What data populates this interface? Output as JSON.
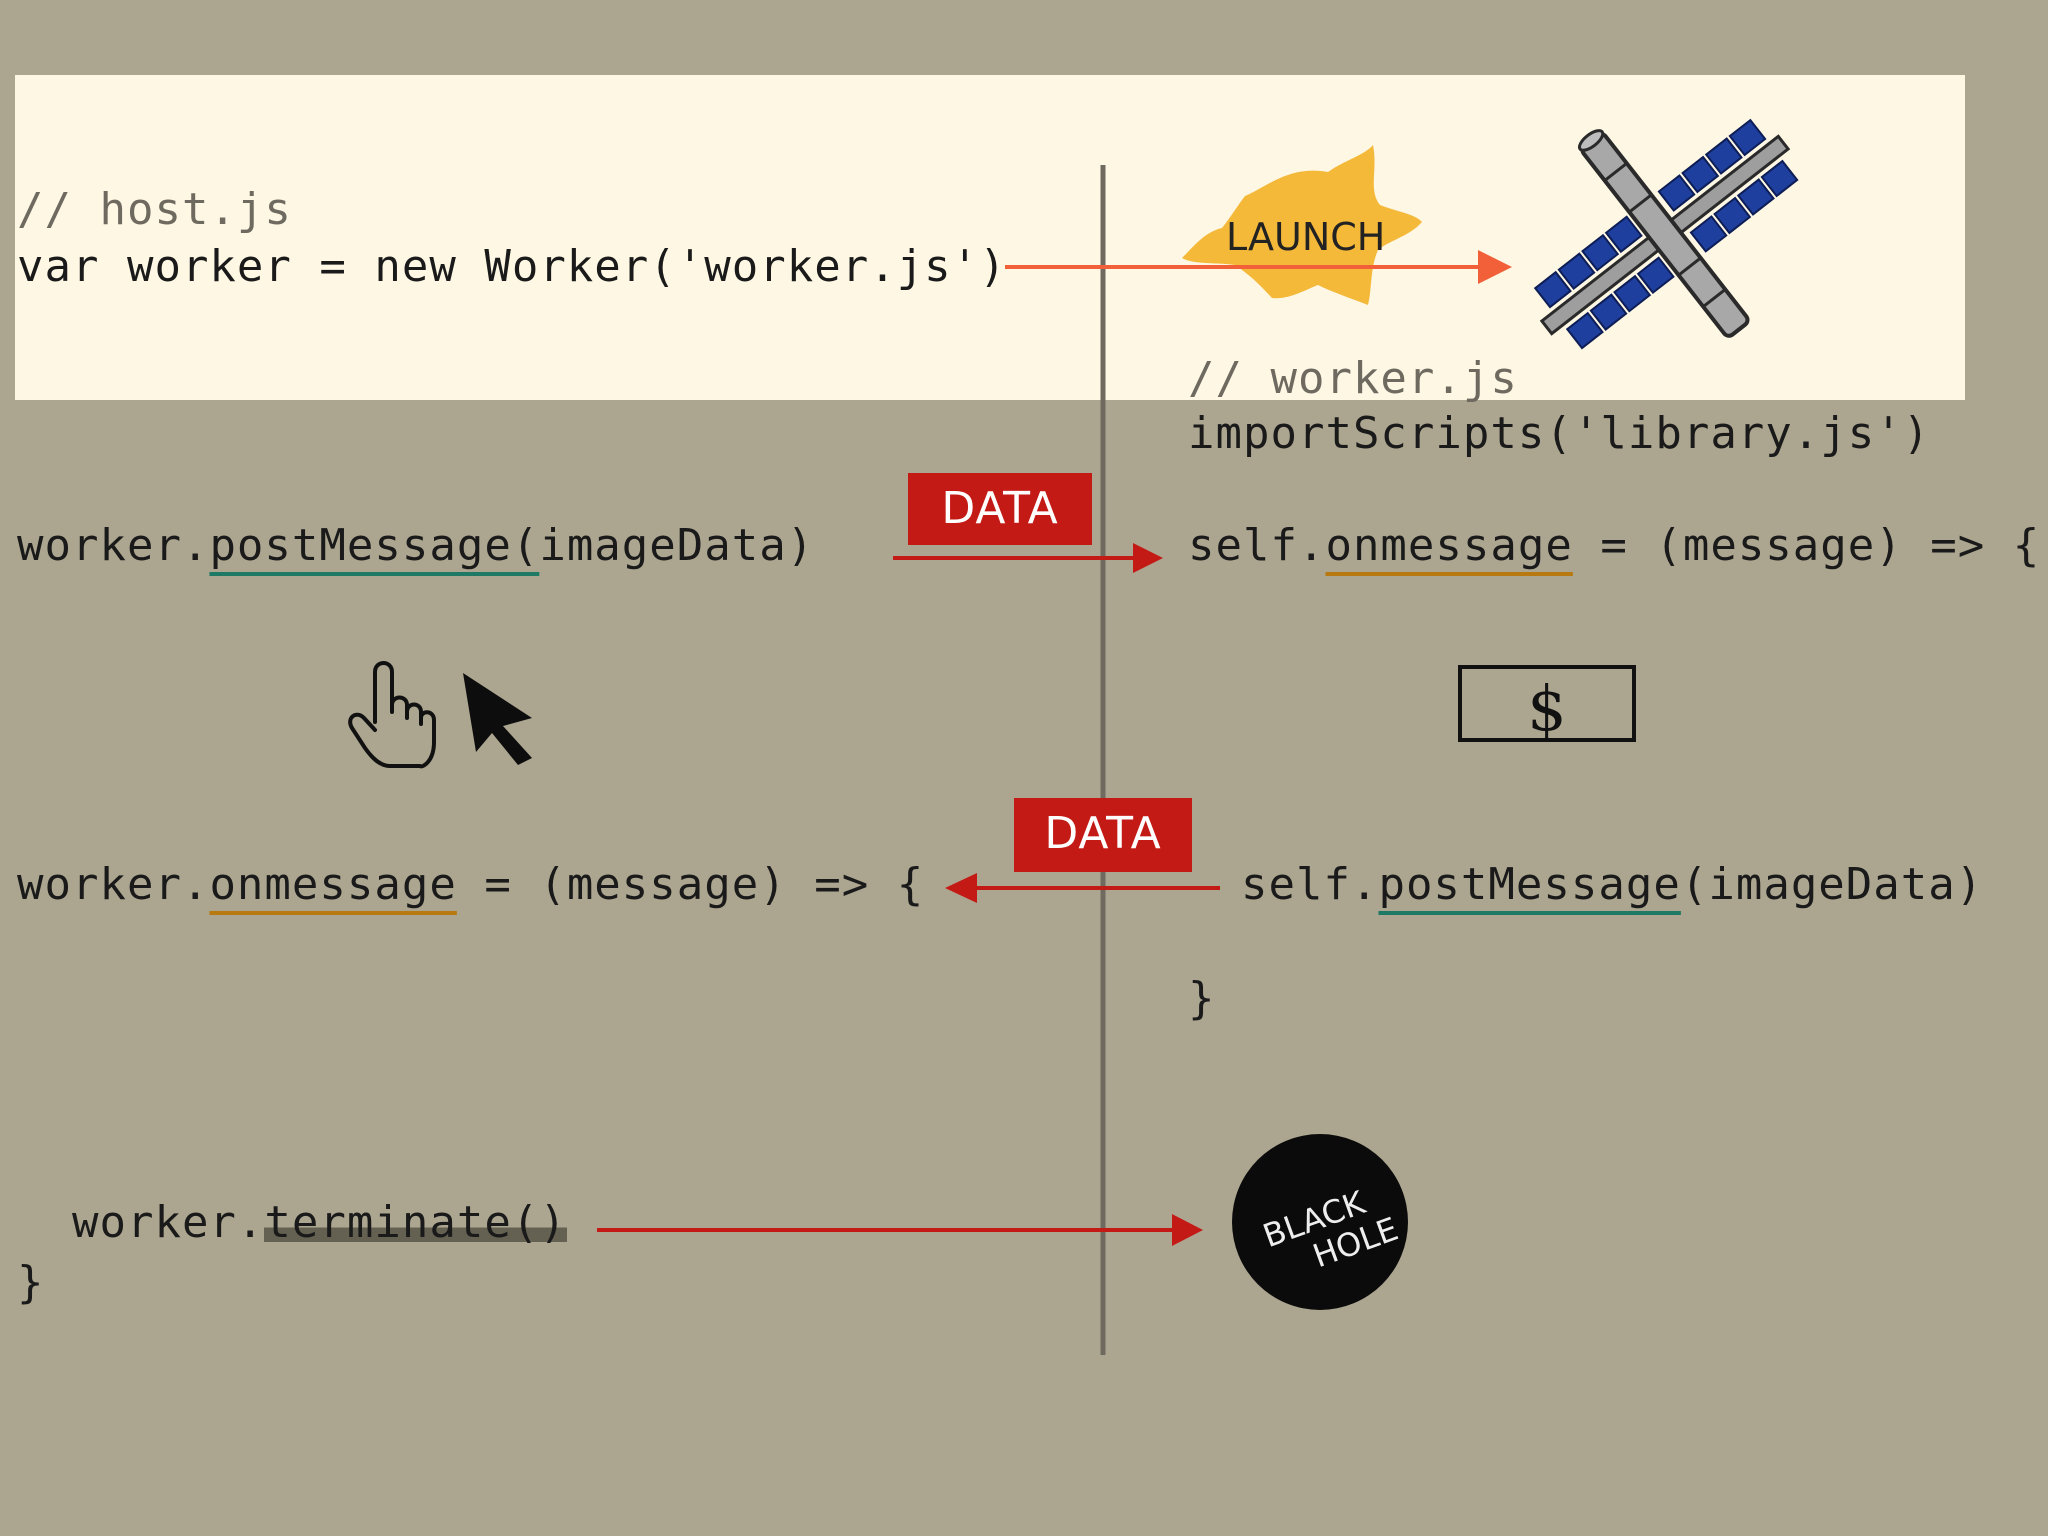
{
  "host": {
    "comment": "// host.js",
    "line_new_worker": "var worker = new Worker('worker.js')",
    "post_prefix": "worker.",
    "post_method": "postMessage(",
    "post_suffix": "imageData)",
    "onmsg_prefix": "worker.",
    "onmsg_method": "onmessage",
    "onmsg_suffix": " = (message) => {",
    "term_prefix": "  worker.",
    "term_method": "terminate()",
    "closing_brace": "}"
  },
  "worker": {
    "comment": "// worker.js",
    "import_line": "importScripts('library.js')",
    "onmsg_prefix": "self.",
    "onmsg_method": "onmessage",
    "onmsg_suffix": " = (message) => {",
    "post_prefix": "self.",
    "post_method": "postMessage",
    "post_suffix": "(imageData)",
    "closing_brace": "}"
  },
  "labels": {
    "launch": "LAUNCH",
    "data_top": "DATA",
    "data_bottom": "DATA",
    "black_hole_line1": "BLACK",
    "black_hole_line2": "HOLE",
    "dollar": "$"
  },
  "colors": {
    "background": "#aca690",
    "highlight": "#fdf7e4",
    "arrow_red": "#c41a16",
    "launch_arrow": "#f2603a",
    "launch_splash": "#f5b93a",
    "underline_green": "#1f7a65",
    "underline_orange": "#b87a10",
    "satellite_panels": "#1f3f9e"
  },
  "icons": [
    "launch-splash-icon",
    "satellite-icon",
    "pointing-hand-icon",
    "cursor-arrow-icon",
    "dollar-bill-icon",
    "black-hole-icon"
  ]
}
